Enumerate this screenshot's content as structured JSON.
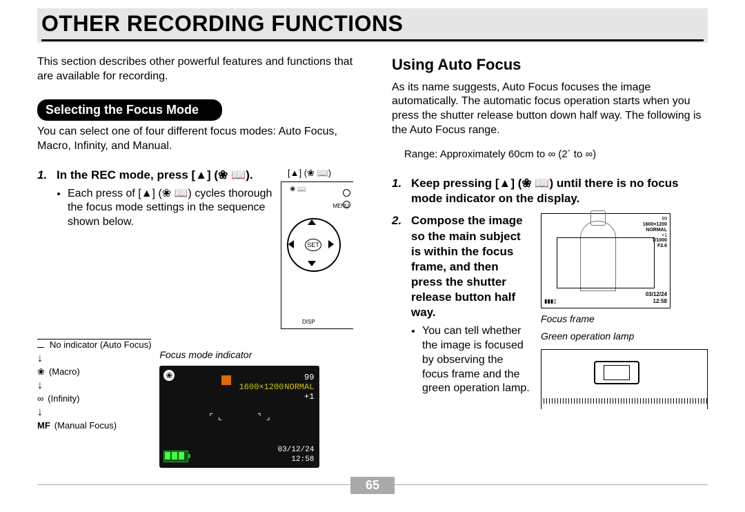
{
  "page_number": "65",
  "title": "OTHER RECORDING FUNCTIONS",
  "intro": "This section describes other powerful features and functions that are available for recording.",
  "left": {
    "panel_title": "Selecting the Focus Mode",
    "panel_desc": "You can select one of four different focus modes: Auto Focus, Macro, Infinity, and Manual.",
    "step1_head": "In the REC mode, press [▲] (❀ 📖).",
    "step1_bullet": "Each press of [▲] (❀ 📖) cycles thorough the focus mode settings in the sequence shown below.",
    "sequence": {
      "auto": "No indicator (Auto Focus)",
      "macro_icon": "❀",
      "macro_label": "(Macro)",
      "infinity_icon": "∞",
      "infinity_label": "(Infinity)",
      "mf_icon": "MF",
      "mf_label": "(Manual Focus)"
    },
    "dpad_caption": "[▲] (❀ 📖)",
    "dpad_menu": "MENU",
    "dpad_set": "SET",
    "dpad_disp": "DISP",
    "focus_indicator_caption": "Focus mode indicator",
    "lcd": {
      "count": "99",
      "res": "1600×1200",
      "quality": "NORMAL",
      "ev": "+1",
      "date": "03/12/24",
      "time": "12:58"
    }
  },
  "right": {
    "heading": "Using Auto Focus",
    "para": "As its name suggests, Auto Focus focuses the image automatically. The automatic focus operation starts when you press the shutter release button down half way. The following is the Auto Focus range.",
    "range": "Range: Approximately 60cm to ∞ (2´ to ∞)",
    "step1": "Keep pressing [▲] (❀ 📖) until there is no focus mode indicator on the display.",
    "step2": "Compose the image so the main subject is within the focus frame, and then press the shutter release button half way.",
    "step2_bullet": "You can tell whether the image is focused by observing the focus frame and the green operation lamp.",
    "screen": {
      "count": "99",
      "res": "1600×1200",
      "quality": "NORMAL",
      "ev": "+1",
      "shutter": "1/1000",
      "fstop": "F2.6",
      "date": "03/12/24",
      "time": "12:58"
    },
    "caption_focus_frame": "Focus frame",
    "caption_green_lamp": "Green operation lamp"
  }
}
